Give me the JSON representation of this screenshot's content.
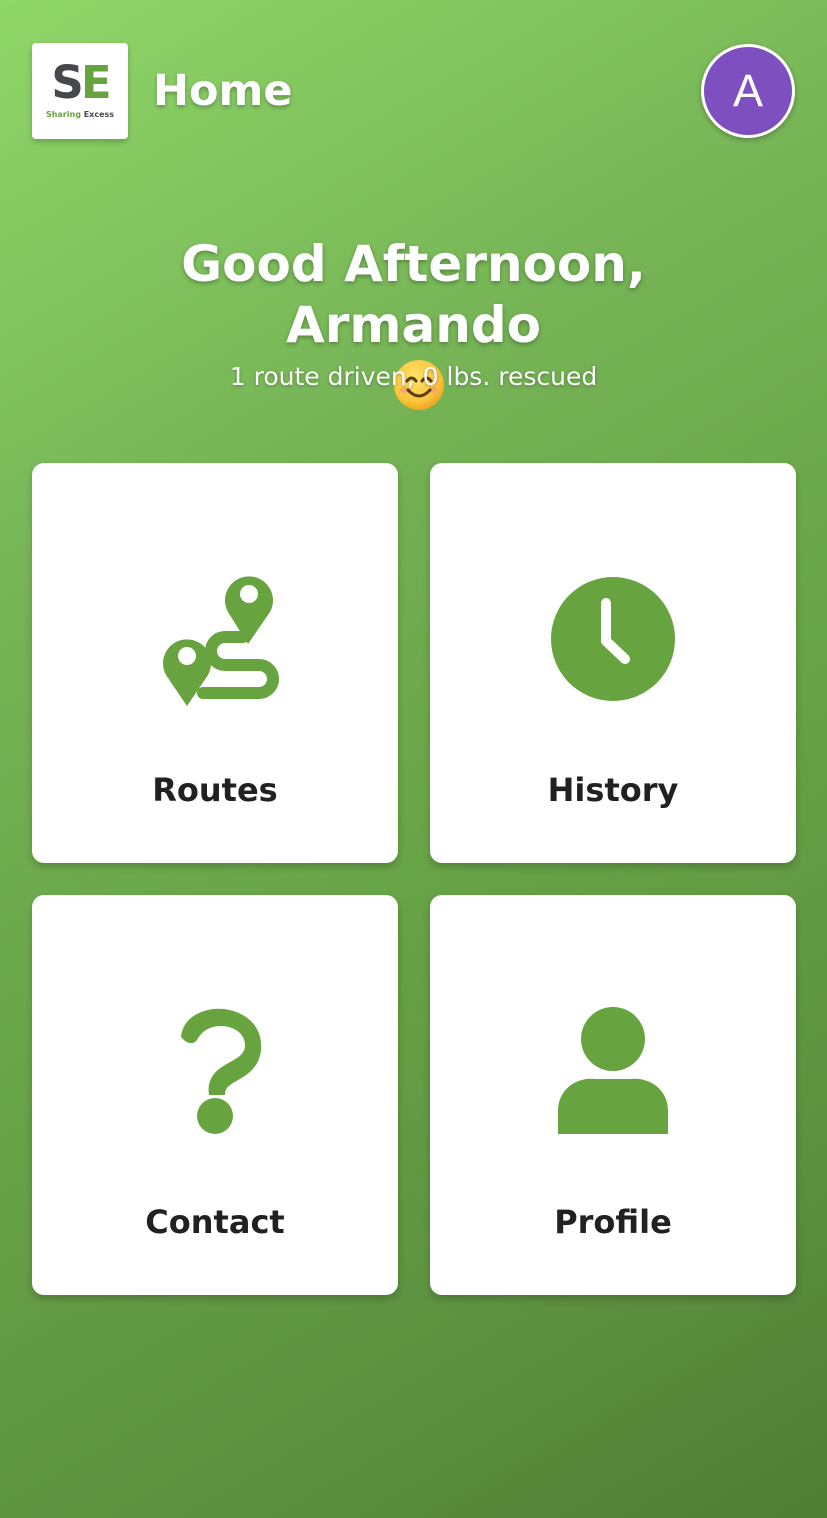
{
  "header": {
    "title": "Home",
    "logo": {
      "mark_s": "S",
      "mark_e": "E",
      "sub_a": "Sharing",
      "sub_b": "Excess"
    },
    "avatar_initial": "A"
  },
  "greeting": {
    "line1": "Good Afternoon,",
    "line2": "Armando",
    "emoji": "smiling-face-icon",
    "stats": "1 route driven, 0 lbs. rescued"
  },
  "tiles": [
    {
      "label": "Routes",
      "icon": "route-icon"
    },
    {
      "label": "History",
      "icon": "clock-icon"
    },
    {
      "label": "Contact",
      "icon": "question-mark-icon"
    },
    {
      "label": "Profile",
      "icon": "user-icon"
    }
  ],
  "colors": {
    "accent": "#67a33e",
    "avatar": "#7e4fbf",
    "background_start": "#8fd668",
    "background_end": "#507d34",
    "tile_text": "#212124"
  }
}
